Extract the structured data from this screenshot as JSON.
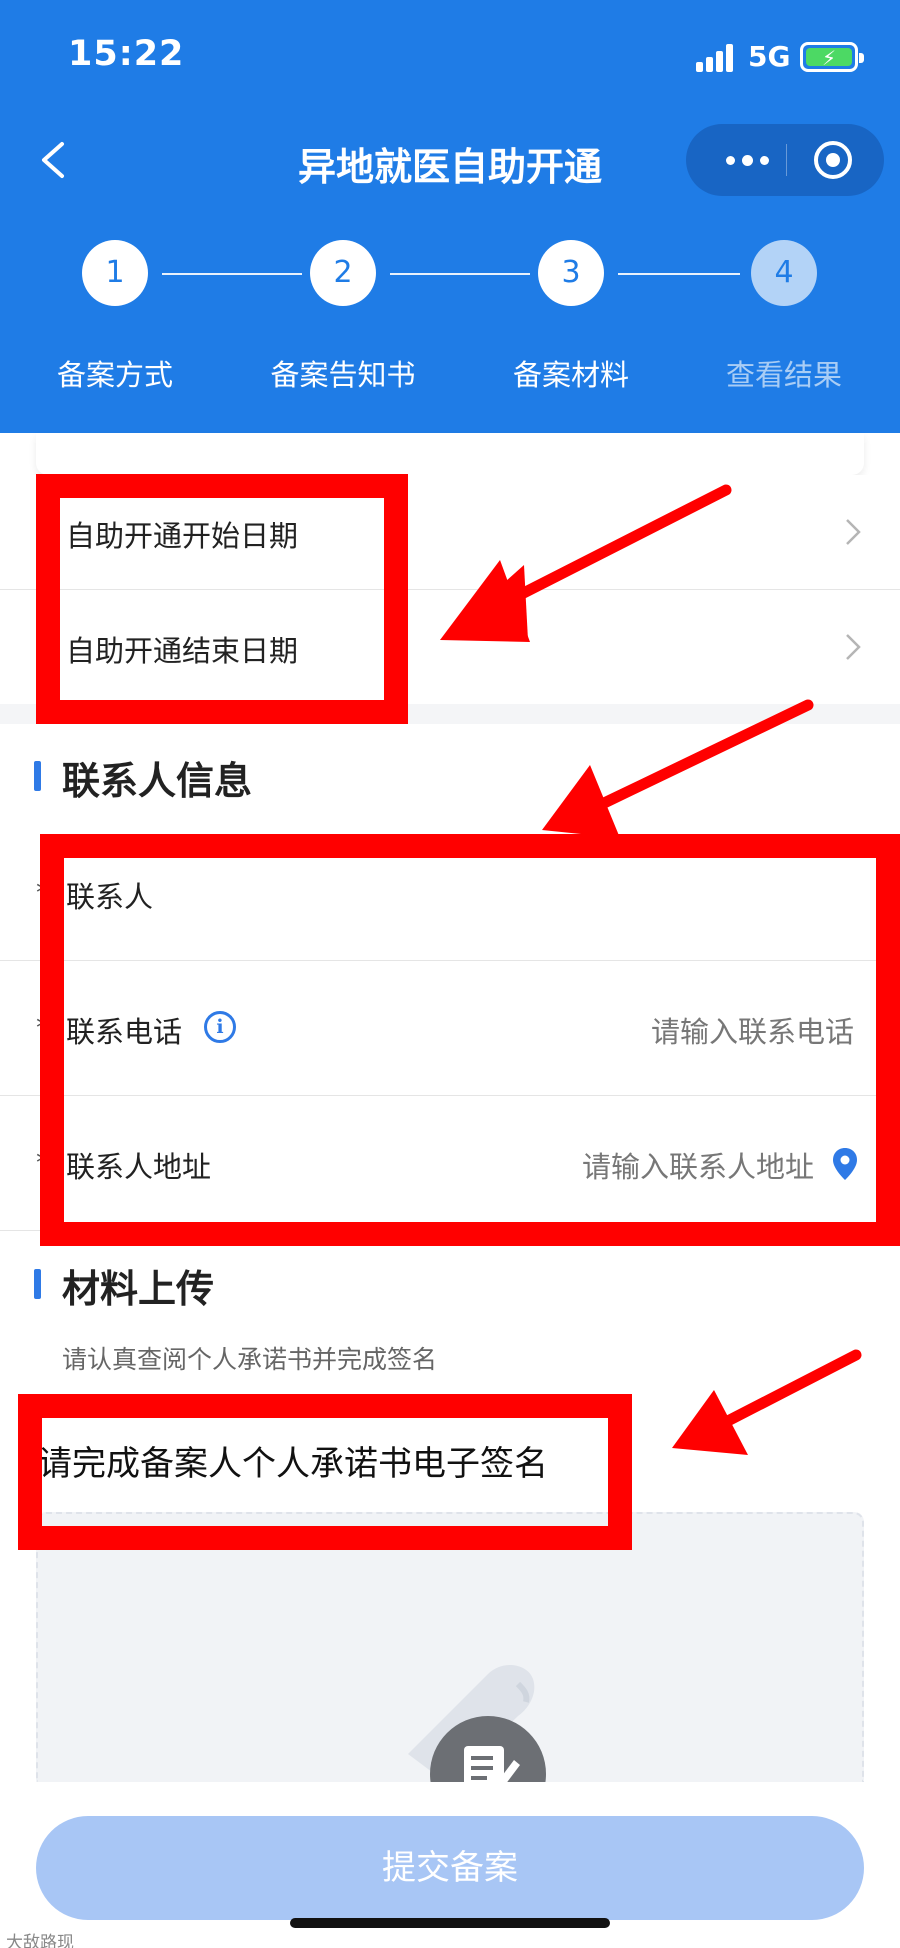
{
  "status_bar": {
    "time": "15:22",
    "network": "5G"
  },
  "nav": {
    "title": "异地就医自助开通"
  },
  "steps": [
    {
      "number": "1",
      "label": "备案方式",
      "state": "done"
    },
    {
      "number": "2",
      "label": "备案告知书",
      "state": "done"
    },
    {
      "number": "3",
      "label": "备案材料",
      "state": "active"
    },
    {
      "number": "4",
      "label": "查看结果",
      "state": "pending"
    }
  ],
  "date_rows": [
    {
      "label": "自助开通开始日期"
    },
    {
      "label": "自助开通结束日期"
    }
  ],
  "contact_section": {
    "title": "联系人信息",
    "contact_label": "联系人",
    "phone_label": "联系电话",
    "phone_placeholder": "请输入联系电话",
    "address_label": "联系人地址",
    "address_placeholder": "请输入联系人地址"
  },
  "upload_section": {
    "title": "材料上传",
    "hint": "请认真查阅个人承诺书并完成签名",
    "sign_title": "请完成备案人个人承诺书电子签名"
  },
  "submit_label": "提交备案",
  "watermark": "大敌路现",
  "colors": {
    "primary": "#1f7ce6",
    "annotation": "#ff0000",
    "submit_disabled": "#a8c6f5"
  }
}
